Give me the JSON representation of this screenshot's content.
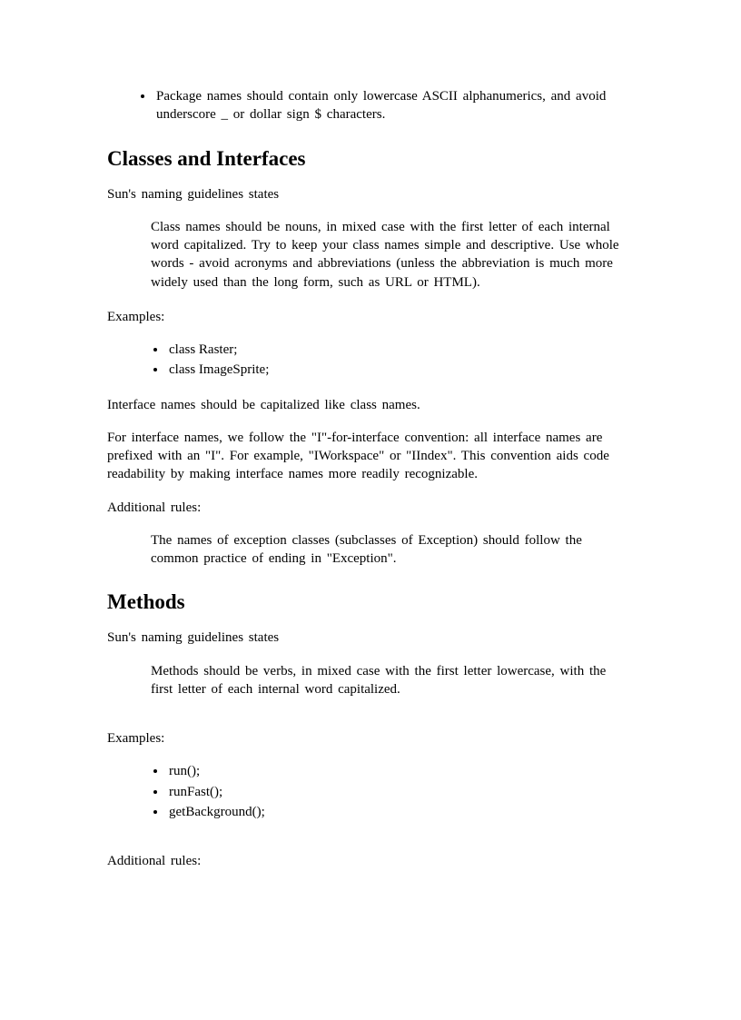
{
  "intro_bullet": "Package names should contain only lowercase ASCII alphanumerics,  and avoid underscore _ or dollar sign $ characters.",
  "section1": {
    "heading": "Classes and Interfaces",
    "intro": "Sun's naming  guidelines   states",
    "quote": "Class names should be nouns,  in mixed  case with the first letter  of each internal word capitalized.   Try to keep your class names simple  and descriptive.   Use whole words - avoid acronyms  and abbreviations   (unless  the abbreviation  is much more widely  used than the long form,  such as URL or HTML).",
    "examples_label": "Examples:",
    "examples": [
      "class Raster;",
      "class ImageSprite;"
    ],
    "para1": "Interface  names should  be capitalized   like class names.",
    "para2": "For interface  names, we follow  the \"I\"-for-interface   convention:   all interface  names are prefixed  with  an \"I\".  For example,  \"IWorkspace\"  or \"IIndex\".  This  convention   aids code readability   by making  interface  names more readily recognizable.",
    "additional_label": "Additional   rules:",
    "additional_quote": "The names of exception  classes  (subclasses  of Exception)  should follow  the common  practice  of ending  in \"Exception\"."
  },
  "section2": {
    "heading": "Methods",
    "intro": "Sun's naming  guidelines   states",
    "quote": "Methods should  be verbs, in mixed  case with  the first letter lowercase,  with the first  letter  of each internal  word capitalized.",
    "examples_label": "Examples:",
    "examples": [
      "run();",
      "runFast();",
      "getBackground();"
    ],
    "additional_label": "Additional   rules:"
  }
}
